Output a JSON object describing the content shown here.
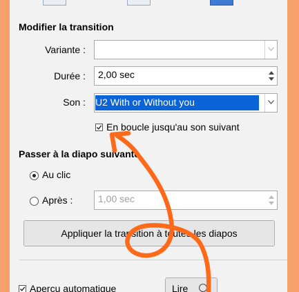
{
  "transition": {
    "heading": "Modifier la transition",
    "variant_label": "Variante :",
    "variant_value": "",
    "duration_label": "Durée :",
    "duration_value": "2,00 sec",
    "sound_label": "Son :",
    "sound_value": "U2 With or Without you",
    "loop_checkbox_label": "En boucle jusqu'au son suivant",
    "loop_checked": true
  },
  "advance": {
    "heading": "Passer à la diapo suivante",
    "on_click_label": "Au clic",
    "on_click_selected": true,
    "after_label": "Après :",
    "after_value": "1,00 sec",
    "after_selected": false
  },
  "apply_button_label": "Appliquer la transition à toutes les diapos",
  "footer": {
    "auto_preview_label": "Aperçu automatique",
    "auto_preview_checked": true,
    "play_button_label": "Lire"
  },
  "colors": {
    "background": "#f7a06b",
    "panel": "#f2f2f2",
    "selection": "#0a64d8",
    "arrow": "#ff6a1a"
  }
}
